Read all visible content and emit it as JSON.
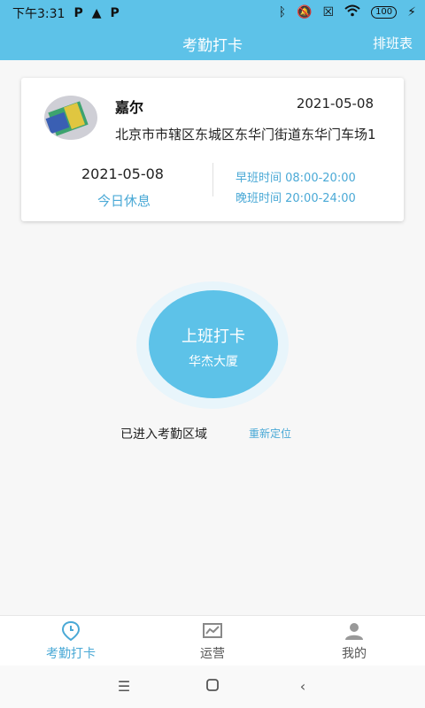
{
  "status_bar": {
    "time": "下午3:31",
    "left_icons": [
      "P",
      "A",
      "P"
    ],
    "right_icons": [
      "bluetooth-icon",
      "mute-icon",
      "sim-off-icon",
      "wifi-icon"
    ],
    "battery": "100",
    "charging_icon": "⚡"
  },
  "header": {
    "title": "考勤打卡",
    "right_button": "排班表"
  },
  "card": {
    "name": "嘉尔",
    "date_top": "2021-05-08",
    "address": "北京市市辖区东城区东华门街道东华门车场1",
    "date": "2021-05-08",
    "status": "今日休息",
    "morning_shift": "早班时间 08:00-20:00",
    "evening_shift": "晚班时间 20:00-24:00"
  },
  "punch": {
    "label": "上班打卡",
    "location": "华杰大厦"
  },
  "area": {
    "status": "已进入考勤区域",
    "relocate": "重新定位"
  },
  "tabs": [
    {
      "label": "考勤打卡",
      "icon": "clock-pin-icon",
      "active": true
    },
    {
      "label": "运营",
      "icon": "chart-icon",
      "active": false
    },
    {
      "label": "我的",
      "icon": "person-icon",
      "active": false
    }
  ],
  "colors": {
    "accent": "#5dc2e8",
    "link": "#4aa9d6",
    "tab_inactive": "#555555"
  }
}
